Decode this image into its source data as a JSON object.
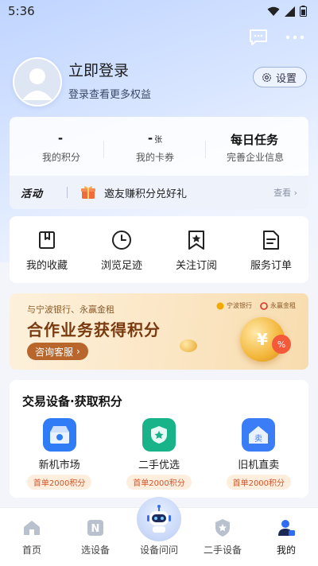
{
  "status_bar": {
    "time": "5:36"
  },
  "profile": {
    "login_title": "立即登录",
    "login_subtitle": "登录查看更多权益",
    "settings_label": "设置"
  },
  "stats": [
    {
      "value": "-",
      "unit": "",
      "label": "我的积分"
    },
    {
      "value": "-",
      "unit": "张",
      "label": "我的卡券"
    },
    {
      "value": "每日任务",
      "unit": "",
      "label": "完善企业信息"
    }
  ],
  "activity": {
    "tag": "活动",
    "text": "邀友赚积分兑好礼",
    "more": "查看"
  },
  "quick_links": [
    {
      "label": "我的收藏",
      "icon": "bookmark-icon"
    },
    {
      "label": "浏览足迹",
      "icon": "clock-icon"
    },
    {
      "label": "关注订阅",
      "icon": "star-bookmark-icon"
    },
    {
      "label": "服务订单",
      "icon": "document-icon"
    }
  ],
  "banner": {
    "top_text": "与宁波银行、永赢金租",
    "title": "合作业务获得积分",
    "button": "咨询客服",
    "logo1": "宁波银行",
    "logo2": "永赢金租"
  },
  "trade": {
    "title": "交易设备·获取积分",
    "items": [
      {
        "name": "新机市场",
        "badge": "首单2000积分",
        "color": "#2f7cf6"
      },
      {
        "name": "二手优选",
        "badge": "首单2000积分",
        "color": "#19b38a"
      },
      {
        "name": "旧机直卖",
        "badge": "首单2000积分",
        "color": "#3a7df7"
      }
    ]
  },
  "tabbar": [
    {
      "label": "首页",
      "icon": "home-icon"
    },
    {
      "label": "选设备",
      "icon": "new-tag-icon"
    },
    {
      "label": "设备问问",
      "icon": "robot-icon"
    },
    {
      "label": "二手设备",
      "icon": "star-badge-icon"
    },
    {
      "label": "我的",
      "icon": "user-icon"
    }
  ]
}
